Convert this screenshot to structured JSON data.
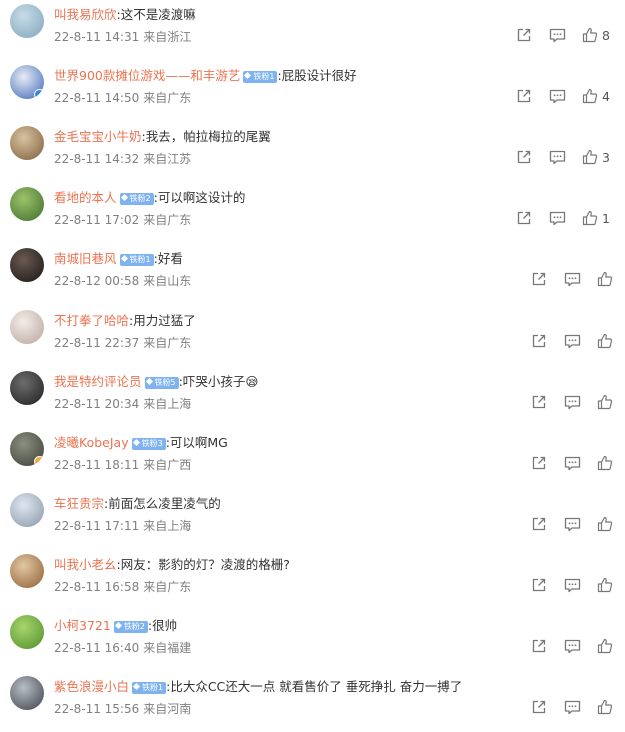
{
  "comments": [
    {
      "user": "叫我易欣欣",
      "badge": "",
      "text": ":这不是凌渡嘛",
      "time": "22-8-11 14:31",
      "location": "来自浙江",
      "likes": "8",
      "avatar": [
        "#c7dbe6",
        "#7fa6bd"
      ],
      "avatar_icon": "person-avatar",
      "verified": ""
    },
    {
      "user": "世界900款摊位游戏——和丰游艺",
      "badge": "铁粉1",
      "text": ":屁股设计很好",
      "time": "22-8-11 14:50",
      "location": "来自广东",
      "likes": "4",
      "avatar": [
        "#e8ecf4",
        "#3a66b7"
      ],
      "avatar_icon": "brand-logo-avatar",
      "verified": "#2f86e0"
    },
    {
      "user": "金毛宝宝小牛奶",
      "badge": "",
      "text": ":我去，帕拉梅拉的尾翼",
      "time": "22-8-11 14:32",
      "location": "来自江苏",
      "likes": "3",
      "avatar": [
        "#d8c3a0",
        "#7d5d3a"
      ],
      "avatar_icon": "dog-avatar",
      "verified": ""
    },
    {
      "user": "看地的本人",
      "badge": "铁粉2",
      "text": ":可以啊这设计的",
      "time": "22-8-11 17:02",
      "location": "来自广东",
      "likes": "1",
      "avatar": [
        "#9bc46a",
        "#3f6b2b"
      ],
      "avatar_icon": "plant-avatar",
      "verified": ""
    },
    {
      "user": "南城旧巷风",
      "badge": "铁粉1",
      "text": ":好看",
      "time": "22-8-12 00:58",
      "location": "来自山东",
      "likes": "",
      "avatar": [
        "#6a5a52",
        "#1a1412"
      ],
      "avatar_icon": "person-avatar",
      "verified": ""
    },
    {
      "user": "不打拳了哈哈",
      "badge": "",
      "text": ":用力过猛了",
      "time": "22-8-11 22:37",
      "location": "来自广东",
      "likes": "",
      "avatar": [
        "#f3ece8",
        "#b9a49a"
      ],
      "avatar_icon": "cat-avatar",
      "verified": ""
    },
    {
      "user": "我是特约评论员",
      "badge": "铁粉5",
      "text": ":吓哭小孩子😪",
      "time": "22-8-11 20:34",
      "location": "来自上海",
      "likes": "",
      "avatar": [
        "#6d6d6d",
        "#1e1e1e"
      ],
      "avatar_icon": "person-avatar",
      "verified": ""
    },
    {
      "user": "凌曦KobeJay",
      "badge": "铁粉3",
      "text": ":可以啊MG",
      "time": "22-8-11 18:11",
      "location": "来自广西",
      "likes": "",
      "avatar": [
        "#8a8f80",
        "#3b3f36"
      ],
      "avatar_icon": "group-avatar",
      "verified": "#f2a93b"
    },
    {
      "user": "车狂贵宗",
      "badge": "",
      "text": ":前面怎么凌里凌气的",
      "time": "22-8-11 17:11",
      "location": "来自上海",
      "likes": "",
      "avatar": [
        "#dfe6ef",
        "#8796a8"
      ],
      "avatar_icon": "car-avatar",
      "verified": ""
    },
    {
      "user": "叫我小老幺",
      "badge": "",
      "text": ":网友：影豹的灯？凌渡的格栅?",
      "time": "22-8-11 16:58",
      "location": "来自广东",
      "likes": "",
      "avatar": [
        "#e2c7a2",
        "#8d5d34"
      ],
      "avatar_icon": "room-avatar",
      "verified": ""
    },
    {
      "user": "小柯3721",
      "badge": "铁粉2",
      "text": ":很帅",
      "time": "22-8-11 16:40",
      "location": "来自福建",
      "likes": "",
      "avatar": [
        "#a8d46d",
        "#4f8f2a"
      ],
      "avatar_icon": "leaf-avatar",
      "verified": ""
    },
    {
      "user": "紫色浪漫小白",
      "badge": "铁粉1",
      "text": ":比大众CC还大一点 就看售价了 垂死挣扎 奋力一搏了",
      "time": "22-8-11 15:56",
      "location": "来自河南",
      "likes": "",
      "avatar": [
        "#b8bec6",
        "#3c4048"
      ],
      "avatar_icon": "person-avatar",
      "verified": ""
    }
  ]
}
